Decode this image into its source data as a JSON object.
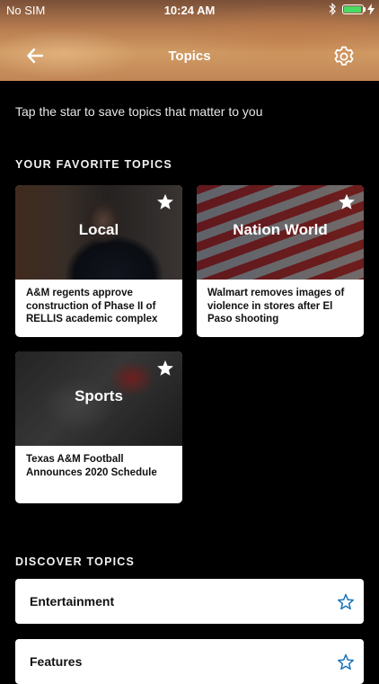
{
  "status_bar": {
    "carrier": "No SIM",
    "time": "10:24 AM",
    "battery_level": 0.95,
    "battery_color": "#4cd964"
  },
  "nav": {
    "title": "Topics",
    "back_icon": "arrow-left-icon",
    "settings_icon": "gear-icon"
  },
  "intro_text": "Tap the star to save topics that matter to you",
  "favorites": {
    "section_title": "YOUR FAVORITE TOPICS",
    "cards": [
      {
        "topic": "Local",
        "headline": "A&M regents approve construction of Phase II of RELLIS academic complex",
        "starred": true
      },
      {
        "topic": "Nation World",
        "headline": "Walmart removes images of violence in stores after El Paso shooting",
        "starred": true
      },
      {
        "topic": "Sports",
        "headline": "Texas A&M Football Announces 2020 Schedule",
        "starred": true
      }
    ]
  },
  "discover": {
    "section_title": "DISCOVER TOPICS",
    "items": [
      {
        "label": "Entertainment",
        "starred": false
      },
      {
        "label": "Features",
        "starred": false
      }
    ]
  },
  "colors": {
    "background": "#000000",
    "star_outline": "#1a73b8",
    "card_background": "#ffffff"
  }
}
